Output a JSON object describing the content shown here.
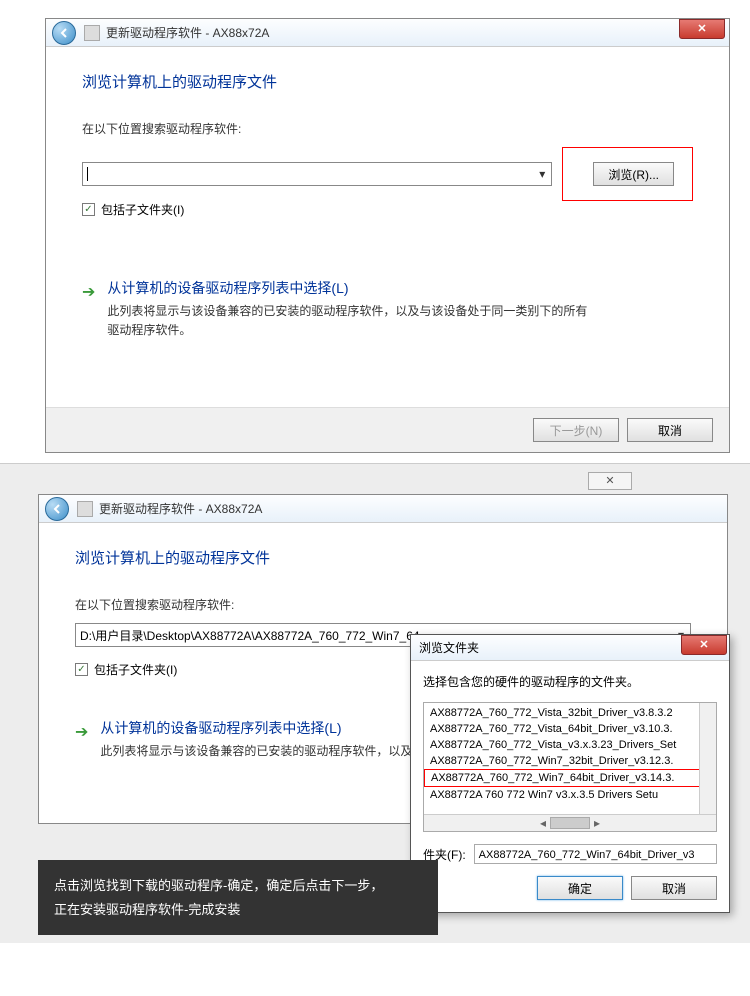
{
  "window1": {
    "title": "更新驱动程序软件 - AX88x72A",
    "heading": "浏览计算机上的驱动程序文件",
    "search_label": "在以下位置搜索驱动程序软件:",
    "path_value": "",
    "browse_label": "浏览(R)...",
    "include_subfolders": "包括子文件夹(I)",
    "option_title": "从计算机的设备驱动程序列表中选择(L)",
    "option_desc": "此列表将显示与该设备兼容的已安装的驱动程序软件，以及与该设备处于同一类别下的所有驱动程序软件。",
    "next_label": "下一步(N)",
    "cancel_label": "取消"
  },
  "window2": {
    "title": "更新驱动程序软件 - AX88x72A",
    "heading": "浏览计算机上的驱动程序文件",
    "search_label": "在以下位置搜索驱动程序软件:",
    "path_value": "D:\\用户目录\\Desktop\\AX88772A\\AX88772A_760_772_Win7_64",
    "include_subfolders": "包括子文件夹(I)",
    "option_title": "从计算机的设备驱动程序列表中选择(L)",
    "option_desc": "此列表将显示与该设备兼容的已安装的驱动程序软件，以及与"
  },
  "folder_dialog": {
    "title": "浏览文件夹",
    "instruction": "选择包含您的硬件的驱动程序的文件夹。",
    "items": [
      "AX88772A_760_772_Vista_32bit_Driver_v3.8.3.2",
      "AX88772A_760_772_Vista_64bit_Driver_v3.10.3.",
      "AX88772A_760_772_Vista_v3.x.3.23_Drivers_Set",
      "AX88772A_760_772_Win7_32bit_Driver_v3.12.3.",
      "AX88772A_760_772_Win7_64bit_Driver_v3.14.3.",
      "AX88772A 760 772 Win7 v3.x.3.5 Drivers Setu"
    ],
    "selected_index": 4,
    "path_label": "件夹(F):",
    "path_value": "AX88772A_760_772_Win7_64bit_Driver_v3",
    "ok_label": "确定",
    "cancel_label": "取消"
  },
  "overlay": {
    "line1": "点击浏览找到下载的驱动程序-确定，确定后点击下一步，",
    "line2": "正在安装驱动程序软件-完成安装"
  }
}
